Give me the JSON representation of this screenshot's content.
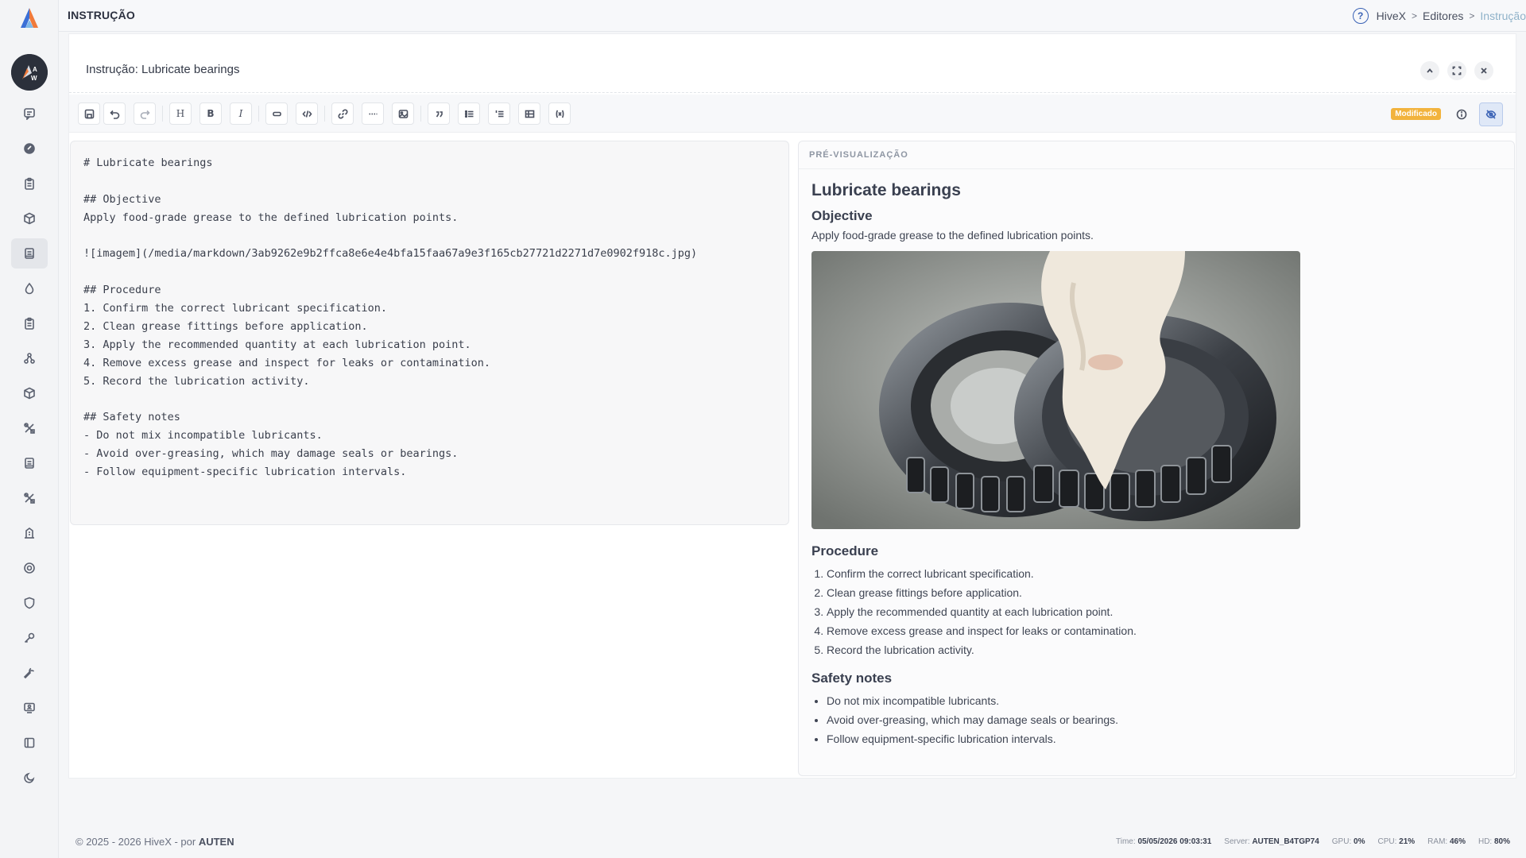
{
  "header": {
    "page_title": "INSTRUÇÃO",
    "breadcrumb": [
      "HiveX",
      "Editores",
      "Instrução"
    ]
  },
  "panel": {
    "title": "Instrução: Lubricate bearings"
  },
  "toolbar": {
    "heading_label": "H",
    "bold_label": "B",
    "italic_label": "I",
    "status_badge": "Modificado"
  },
  "editor": {
    "lines": [
      "# Lubricate bearings",
      "",
      "## Objective",
      "Apply food-grade grease to the defined lubrication points.",
      "",
      "![imagem](/media/markdown/3ab9262e9b2ffca8e6e4e4bfa15faa67a9e3f165cb27721d2271d7e0902f918c.jpg)",
      "",
      "## Procedure",
      "1. Confirm the correct lubricant specification.",
      "2. Clean grease fittings before application.",
      "3. Apply the recommended quantity at each lubrication point.",
      "4. Remove excess grease and inspect for leaks or contamination.",
      "5. Record the lubrication activity.",
      "",
      "## Safety notes",
      "- Do not mix incompatible lubricants.",
      "- Avoid over-greasing, which may damage seals or bearings.",
      "- Follow equipment-specific lubrication intervals."
    ]
  },
  "preview": {
    "label": "PRÉ-VISUALIZAÇÃO",
    "h1": "Lubricate bearings",
    "objective_heading": "Objective",
    "objective_text": "Apply food-grade grease to the defined lubrication points.",
    "procedure_heading": "Procedure",
    "procedure_items": [
      "Confirm the correct lubricant specification.",
      "Clean grease fittings before application.",
      "Apply the recommended quantity at each lubrication point.",
      "Remove excess grease and inspect for leaks or contamination.",
      "Record the lubrication activity."
    ],
    "safety_heading": "Safety notes",
    "safety_items": [
      "Do not mix incompatible lubricants.",
      "Avoid over-greasing, which may damage seals or bearings.",
      "Follow equipment-specific lubrication intervals."
    ]
  },
  "footer": {
    "copyright": "© 2025 - 2026 HiveX - por",
    "company": "AUTEN",
    "time_label": "Time:",
    "time_value": "05/05/2026 09:03:31",
    "server_label": "Server:",
    "server_value": "AUTEN_B4TGP74",
    "gpu_label": "GPU:",
    "gpu_value": "0%",
    "cpu_label": "CPU:",
    "cpu_value": "21%",
    "ram_label": "RAM:",
    "ram_value": "46%",
    "hd_label": "HD:",
    "hd_value": "80%"
  },
  "avatar_letters": "A W",
  "colors": {
    "accent": "#3a62b5",
    "badge": "#f2b33d",
    "breadcrumb_current": "#8fb2c9"
  },
  "icons": {
    "sidebar": [
      "chat-icon",
      "dashboard-icon",
      "clipboard-icon",
      "box-icon",
      "document-icon",
      "drop-icon",
      "clipboard-list-icon",
      "nodes-icon",
      "package-icon",
      "tools-icon",
      "notebook-icon",
      "tools-cross-icon",
      "building-icon",
      "settings-icon",
      "shield-icon",
      "key-icon",
      "wrench-icon",
      "monitor-user-icon",
      "sidebar-toggle-icon",
      "moon-icon"
    ]
  }
}
